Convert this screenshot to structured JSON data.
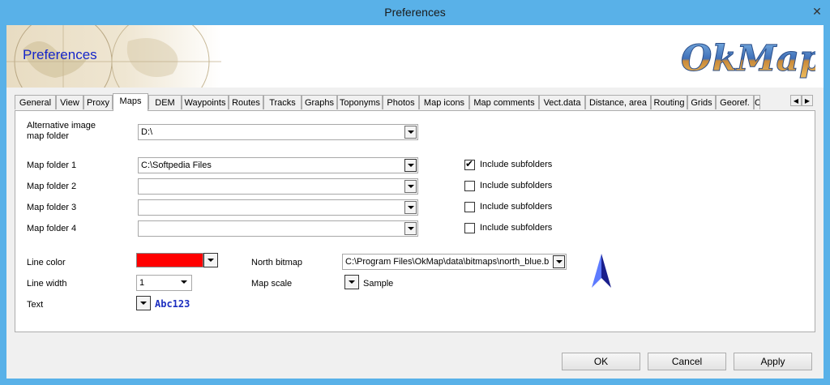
{
  "window": {
    "title": "Preferences",
    "close_glyph": "✕"
  },
  "banner": {
    "title": "Preferences",
    "logo_text": "OkMap"
  },
  "tabs": [
    {
      "label": "General"
    },
    {
      "label": "View"
    },
    {
      "label": "Proxy"
    },
    {
      "label": "Maps"
    },
    {
      "label": "DEM"
    },
    {
      "label": "Waypoints"
    },
    {
      "label": "Routes"
    },
    {
      "label": "Tracks"
    },
    {
      "label": "Graphs"
    },
    {
      "label": "Toponyms"
    },
    {
      "label": "Photos"
    },
    {
      "label": "Map icons"
    },
    {
      "label": "Map comments"
    },
    {
      "label": "Vect.data"
    },
    {
      "label": "Distance, area"
    },
    {
      "label": "Routing"
    },
    {
      "label": "Grids"
    },
    {
      "label": "Georef."
    },
    {
      "label": "C"
    }
  ],
  "active_tab": "Maps",
  "maps": {
    "alt_folder": {
      "label_line1": "Alternative image",
      "label_line2": "map folder",
      "value": "D:\\"
    },
    "folders": [
      {
        "label": "Map folder 1",
        "value": "C:\\Softpedia Files",
        "include_label": "Include subfolders",
        "include_checked": true
      },
      {
        "label": "Map folder 2",
        "value": "",
        "include_label": "Include subfolders",
        "include_checked": false
      },
      {
        "label": "Map folder 3",
        "value": "",
        "include_label": "Include subfolders",
        "include_checked": false
      },
      {
        "label": "Map folder 4",
        "value": "",
        "include_label": "Include subfolders",
        "include_checked": false
      }
    ],
    "line_color": {
      "label": "Line color",
      "color": "#ff0000"
    },
    "line_width": {
      "label": "Line width",
      "value": "1"
    },
    "text": {
      "label": "Text",
      "sample": "Abc123"
    },
    "north_bitmap": {
      "label": "North bitmap",
      "value": "C:\\Program Files\\OkMap\\data\\bitmaps\\north_blue.bmp"
    },
    "map_scale": {
      "label": "Map scale",
      "sample": "Sample"
    }
  },
  "buttons": {
    "ok": "OK",
    "cancel": "Cancel",
    "apply": "Apply"
  },
  "colors": {
    "titlebar": "#59b1e8",
    "banner_title": "#1525c9",
    "arrow_blue": "#3b4be0"
  }
}
